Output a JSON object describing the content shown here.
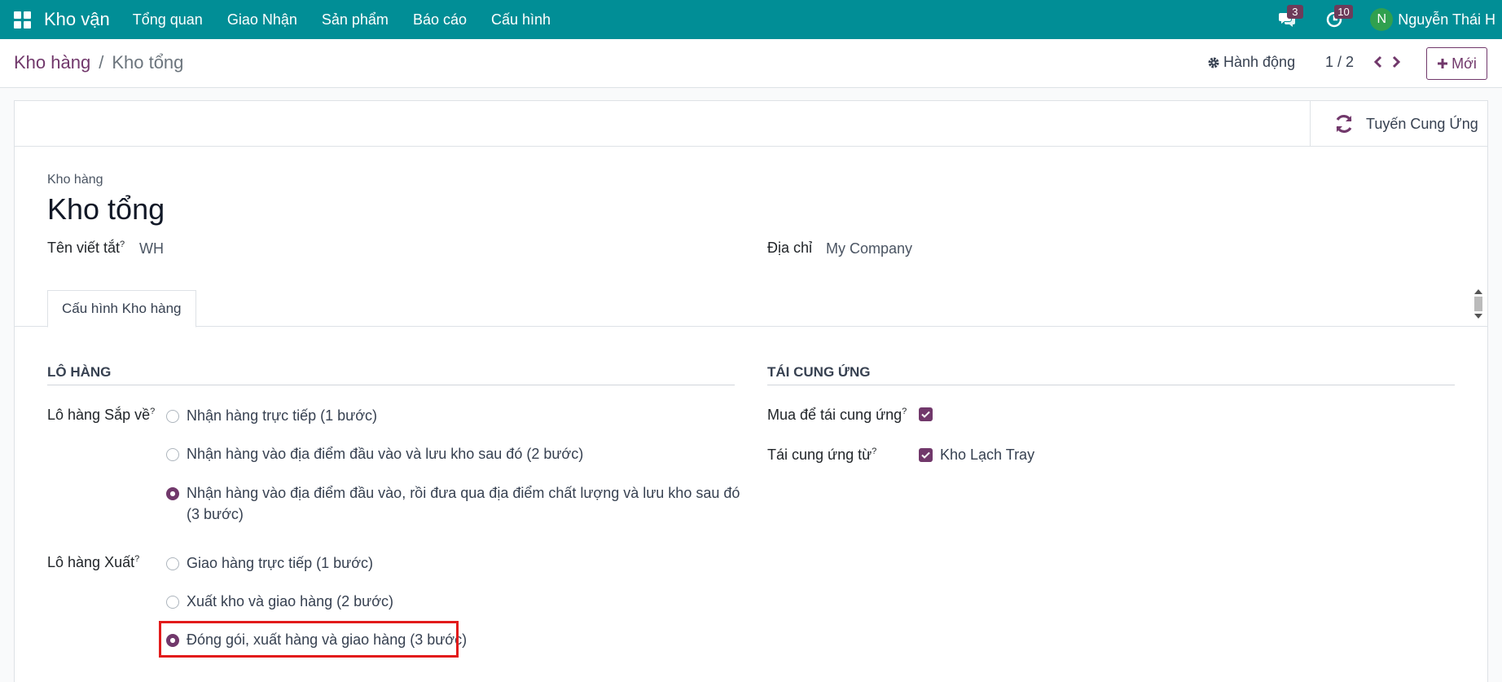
{
  "navbar": {
    "app_name": "Kho vận",
    "menu": [
      "Tổng quan",
      "Giao Nhận",
      "Sản phẩm",
      "Báo cáo",
      "Cấu hình"
    ],
    "messages_badge": "3",
    "activities_badge": "10",
    "user_initial": "N",
    "user_name": "Nguyễn Thái H",
    "bg_color": "#018e96"
  },
  "breadcrumb": {
    "parent": "Kho hàng",
    "separator": "/",
    "current": "Kho tổng"
  },
  "control": {
    "action_label": "Hành động",
    "pager": "1 / 2",
    "new_label": "Mới"
  },
  "button_box": {
    "routes_label": "Tuyến Cung Ứng"
  },
  "form": {
    "title_label": "Kho hàng",
    "title": "Kho tổng",
    "short_name_label": "Tên viết tắt",
    "short_name_value": "WH",
    "address_label": "Địa chỉ",
    "address_value": "My Company",
    "tab_label": "Cấu hình Kho hàng",
    "shipments": {
      "section_title": "LÔ HÀNG",
      "incoming_label": "Lô hàng Sắp về",
      "incoming_options": [
        {
          "label": "Nhận hàng trực tiếp (1 bước)",
          "checked": false
        },
        {
          "label": "Nhận hàng vào địa điểm đầu vào và lưu kho sau đó (2 bước)",
          "checked": false
        },
        {
          "label": "Nhận hàng vào địa điểm đầu vào, rồi đưa qua địa điểm chất lượng và lưu kho sau đó (3 bước)",
          "checked": true
        }
      ],
      "outgoing_label": "Lô hàng Xuất",
      "outgoing_options": [
        {
          "label": "Giao hàng trực tiếp (1 bước)",
          "checked": false
        },
        {
          "label": "Xuất kho và giao hàng (2 bước)",
          "checked": false
        },
        {
          "label": "Đóng gói, xuất hàng và giao hàng (3 bước)",
          "checked": true
        }
      ]
    },
    "resupply": {
      "section_title": "TÁI CUNG ỨNG",
      "buy_label": "Mua để tái cung ứng",
      "buy_checked": true,
      "resupply_from_label": "Tái cung ứng từ",
      "resupply_from_value": "Kho Lạch Tray",
      "resupply_from_checked": true
    }
  },
  "accent_color": "#71386b",
  "highlight_color": "#e21b1b"
}
